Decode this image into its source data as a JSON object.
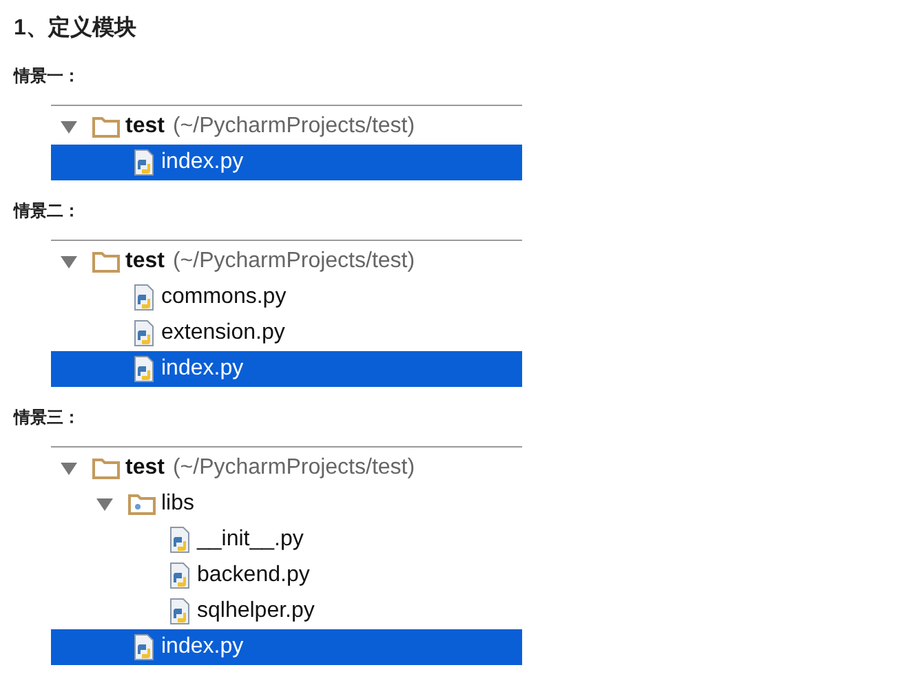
{
  "heading": "1、定义模块",
  "scenarios": [
    {
      "label": "情景一：",
      "tree": {
        "kind": "folder",
        "name": "test",
        "path": "(~/PycharmProjects/test)",
        "expanded": true,
        "selected": false,
        "children": [
          {
            "kind": "file",
            "name": "index.py",
            "selected": true
          }
        ]
      }
    },
    {
      "label": "情景二：",
      "tree": {
        "kind": "folder",
        "name": "test",
        "path": "(~/PycharmProjects/test)",
        "expanded": true,
        "selected": false,
        "children": [
          {
            "kind": "file",
            "name": "commons.py",
            "selected": false
          },
          {
            "kind": "file",
            "name": "extension.py",
            "selected": false
          },
          {
            "kind": "file",
            "name": "index.py",
            "selected": true
          }
        ]
      }
    },
    {
      "label": "情景三：",
      "tree": {
        "kind": "folder",
        "name": "test",
        "path": "(~/PycharmProjects/test)",
        "expanded": true,
        "selected": false,
        "children": [
          {
            "kind": "package",
            "name": "libs",
            "expanded": true,
            "selected": false,
            "children": [
              {
                "kind": "file",
                "name": "__init__.py",
                "selected": false
              },
              {
                "kind": "file",
                "name": "backend.py",
                "selected": false
              },
              {
                "kind": "file",
                "name": "sqlhelper.py",
                "selected": false
              }
            ]
          },
          {
            "kind": "file",
            "name": "index.py",
            "selected": true
          }
        ]
      }
    }
  ]
}
